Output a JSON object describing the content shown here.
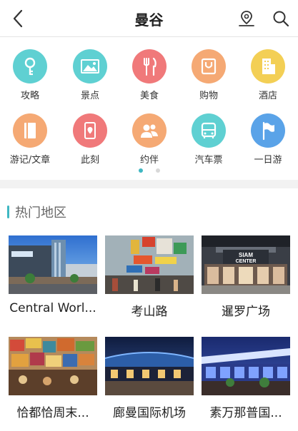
{
  "header": {
    "title": "曼谷",
    "back_icon": "chevron-left-icon",
    "location_icon": "map-pin-icon",
    "search_icon": "search-icon"
  },
  "categories": [
    {
      "label": "攻略",
      "icon": "key-icon",
      "color": "#5fd0d2"
    },
    {
      "label": "景点",
      "icon": "landscape-icon",
      "color": "#5fd0d2"
    },
    {
      "label": "美食",
      "icon": "fork-knife-icon",
      "color": "#f0797a"
    },
    {
      "label": "购物",
      "icon": "shopping-bag-icon",
      "color": "#f5a974"
    },
    {
      "label": "酒店",
      "icon": "building-icon",
      "color": "#f3cf55"
    },
    {
      "label": "游记/文章",
      "icon": "book-icon",
      "color": "#f5a974"
    },
    {
      "label": "此刻",
      "icon": "phone-pin-icon",
      "color": "#f0797a"
    },
    {
      "label": "约伴",
      "icon": "people-icon",
      "color": "#f5a974"
    },
    {
      "label": "汽车票",
      "icon": "bus-icon",
      "color": "#5fd0d2"
    },
    {
      "label": "一日游",
      "icon": "flag-icon",
      "color": "#5aa3e8"
    }
  ],
  "pager": {
    "pages": 2,
    "active": 1
  },
  "hot_section": {
    "title": "热门地区",
    "accent": "#3fb7c2",
    "places": [
      {
        "name": "Central Worl...",
        "image": "mall-photo"
      },
      {
        "name": "考山路",
        "image": "street-photo"
      },
      {
        "name": "暹罗广场",
        "image": "siam-center-photo"
      },
      {
        "name": "恰都恰周末...",
        "image": "market-photo"
      },
      {
        "name": "廊曼国际机场",
        "image": "airport-photo"
      },
      {
        "name": "素万那普国...",
        "image": "airport-night-photo"
      }
    ]
  }
}
